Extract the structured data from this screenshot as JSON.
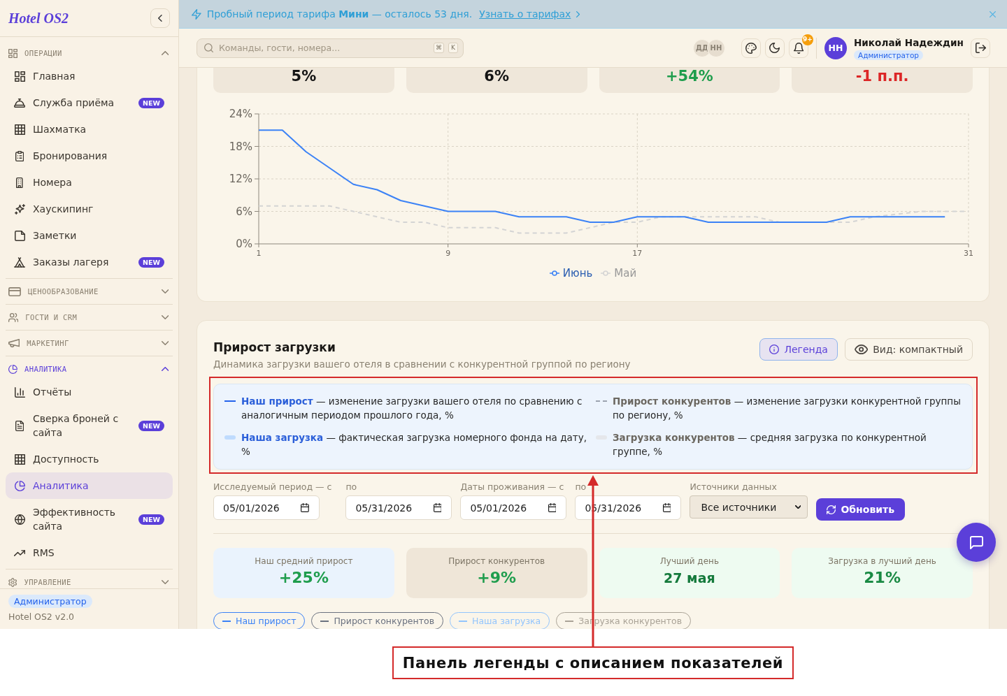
{
  "sidebar": {
    "logo": "Hotel OS2",
    "sections": [
      {
        "title": "ОПЕРАЦИИ",
        "expanded": true,
        "active": false,
        "items": [
          {
            "label": "Главная",
            "selected": false
          },
          {
            "label": "Служба приёма",
            "badge": "NEW",
            "selected": false
          },
          {
            "label": "Шахматка",
            "selected": false
          },
          {
            "label": "Бронирования",
            "selected": false
          },
          {
            "label": "Номера",
            "selected": false
          },
          {
            "label": "Хаускипинг",
            "selected": false
          },
          {
            "label": "Заметки",
            "selected": false
          },
          {
            "label": "Заказы лагеря",
            "badge": "NEW",
            "selected": false
          }
        ]
      },
      {
        "title": "ЦЕНООБРАЗОВАНИЕ",
        "expanded": false,
        "active": false
      },
      {
        "title": "ГОСТИ И CRM",
        "expanded": false,
        "active": false
      },
      {
        "title": "МАРКЕТИНГ",
        "expanded": false,
        "active": false
      },
      {
        "title": "АНАЛИТИКА",
        "expanded": true,
        "active": true,
        "items": [
          {
            "label": "Отчёты",
            "selected": false
          },
          {
            "label": "Сверка броней с сайта",
            "badge": "NEW",
            "selected": false
          },
          {
            "label": "Доступность",
            "selected": false
          },
          {
            "label": "Аналитика",
            "selected": true
          },
          {
            "label": "Эффективность сайта",
            "badge": "NEW",
            "selected": false
          },
          {
            "label": "RMS",
            "selected": false
          }
        ]
      },
      {
        "title": "УПРАВЛЕНИЕ",
        "expanded": false,
        "active": false
      }
    ],
    "footer": {
      "role": "Администратор",
      "version": "Hotel OS2 v2.0"
    }
  },
  "banner": {
    "text": "Пробный период тарифа **Мини** — осталось 53 дня.",
    "link": "Узнать о тарифах"
  },
  "topbar": {
    "search": {
      "placeholder": "Команды, гости, номера...",
      "shortcut": [
        "⌘",
        "K"
      ]
    },
    "presence": [
      "ДД",
      "НН"
    ],
    "notifications": "9+",
    "user": {
      "initials": "НН",
      "name": "Николай Надеждин",
      "role": "Администратор"
    }
  },
  "occupancy_card": {
    "summary": [
      {
        "value": "5%",
        "kind": "neutral"
      },
      {
        "value": "6%",
        "kind": "neutral"
      },
      {
        "value": "+54%",
        "kind": "positive"
      },
      {
        "value": "-1 п.п.",
        "kind": "negative"
      }
    ],
    "chart_data": {
      "type": "line",
      "x": [
        1,
        2,
        3,
        4,
        5,
        6,
        7,
        8,
        9,
        10,
        11,
        12,
        13,
        14,
        15,
        16,
        17,
        18,
        19,
        20,
        21,
        22,
        23,
        24,
        25,
        26,
        27,
        28,
        29,
        30,
        31
      ],
      "series": [
        {
          "name": "Июнь",
          "color": "#3b82f6",
          "line_style": "solid",
          "values": [
            21,
            21,
            17,
            14,
            11,
            10,
            8,
            7,
            6,
            6,
            6,
            5,
            5,
            5,
            4,
            4,
            5,
            5,
            5,
            4,
            4,
            4,
            4,
            4,
            4,
            5,
            5,
            5,
            5,
            5,
            null
          ]
        },
        {
          "name": "Май",
          "color": "#d4d4d4",
          "line_style": "dashed",
          "values": [
            7,
            7,
            7,
            7,
            6,
            5,
            4,
            4,
            3,
            3,
            3,
            2,
            2,
            2,
            3,
            4,
            4,
            5,
            5,
            5,
            5,
            5,
            4,
            4,
            4,
            4,
            5,
            5.5,
            6,
            6,
            6
          ]
        }
      ],
      "xlim": [
        1,
        31
      ],
      "ylim": [
        0,
        24
      ],
      "xticks": [
        1,
        9,
        17,
        31
      ],
      "yticks": [
        {
          "value": 0,
          "label": "0%"
        },
        {
          "value": 6,
          "label": "6%"
        },
        {
          "value": 12,
          "label": "12%"
        },
        {
          "value": 18,
          "label": "18%"
        },
        {
          "value": 24,
          "label": "24%"
        }
      ],
      "grid": true,
      "legend": "bottom"
    }
  },
  "growth_card": {
    "title": "Прирост загрузки",
    "subtitle": "Динамика загрузки вашего отеля в сравнении с конкурентной группой по региону",
    "toolbar": [
      {
        "label": "Легенда",
        "kind": "legend",
        "selected": true
      },
      {
        "label": "Вид: компактный",
        "kind": "view",
        "selected": false
      }
    ],
    "legend": [
      {
        "text": "**Наш прирост** — изменение загрузки вашего отеля по сравнению с аналогичным периодом прошлого года, %",
        "kind": "ownline",
        "color": "#2563eb"
      },
      {
        "text": "**Прирост конкурентов** — изменение загрузки конкурентной группы по региону, %",
        "kind": "rivalline",
        "color": "#9ca3af"
      },
      {
        "text": "**Наша загрузка** — фактическая загрузка номерного фонда на дату, %",
        "kind": "ownband",
        "color": "#bfdbfe"
      },
      {
        "text": "**Загрузка конкурентов** — средняя загрузка по конкурентной группе, %",
        "kind": "rivalband",
        "color": "#e5e7eb"
      }
    ],
    "filters": [
      {
        "label": "Исследуемый период — с",
        "value": "05/01/2026",
        "kind": "date"
      },
      {
        "label": "по",
        "value": "05/31/2026",
        "kind": "date"
      },
      {
        "label": "Даты проживания — с",
        "value": "05/01/2026",
        "kind": "date"
      },
      {
        "label": "по",
        "value": "05/31/2026",
        "kind": "date"
      },
      {
        "label": "Источники данных",
        "value": "Все источники",
        "kind": "select"
      }
    ],
    "refresh_button": "Обновить",
    "stats": [
      {
        "label": "Наш средний прирост",
        "value": "+25%",
        "kind": "own"
      },
      {
        "label": "Прирост конкурентов",
        "value": "+9%",
        "kind": "competitor"
      },
      {
        "label": "Лучший день",
        "value": "27 мая",
        "kind": "date"
      },
      {
        "label": "Загрузка в лучший день",
        "value": "21%",
        "kind": "best"
      }
    ],
    "series_toggles": [
      {
        "label": "Наш прирост",
        "color": "#3b82f6"
      },
      {
        "label": "Прирост конкурентов",
        "color": "#6b7280"
      },
      {
        "label": "Наша загрузка",
        "color": "#93c5fd"
      },
      {
        "label": "Загрузка конкурентов",
        "color": "#aaa397"
      }
    ]
  },
  "annotation": {
    "caption": "Панель легенды с описанием показателей"
  }
}
